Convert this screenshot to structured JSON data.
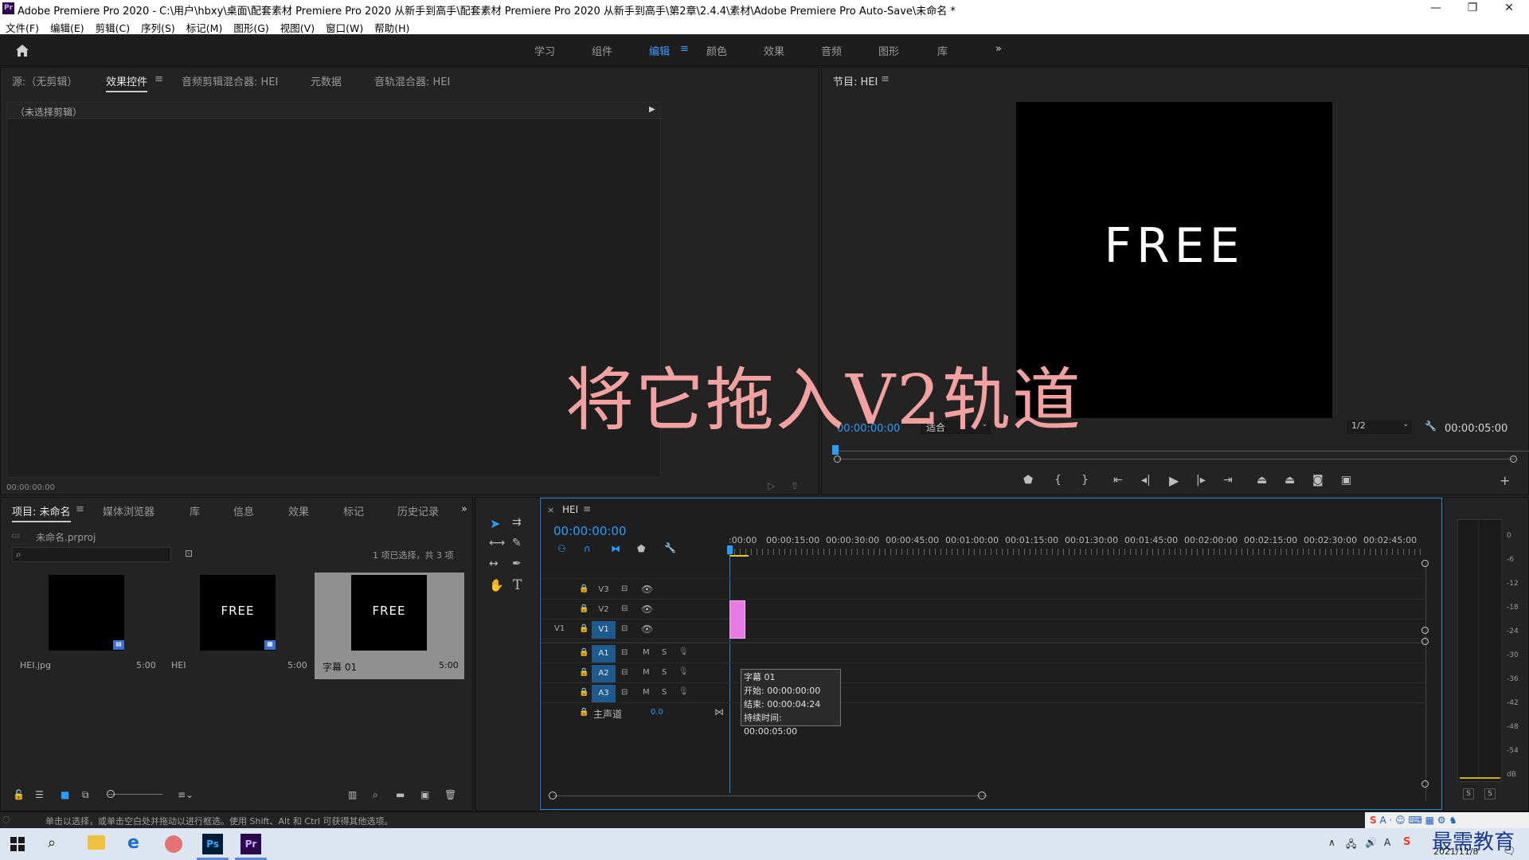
{
  "window": {
    "app_icon": "Pr",
    "title": "Adobe Premiere Pro 2020 - C:\\用户\\hbxy\\桌面\\配套素材 Premiere Pro 2020 从新手到高手\\配套素材 Premiere Pro 2020 从新手到高手\\第2章\\2.4.4\\素材\\Adobe Premiere Pro Auto-Save\\未命名 *",
    "minimize": "—",
    "maximize": "❐",
    "close": "✕"
  },
  "menu": [
    "文件(F)",
    "编辑(E)",
    "剪辑(C)",
    "序列(S)",
    "标记(M)",
    "图形(G)",
    "视图(V)",
    "窗口(W)",
    "帮助(H)"
  ],
  "workspaces": {
    "items": [
      "学习",
      "组件",
      "编辑",
      "颜色",
      "效果",
      "音频",
      "图形",
      "库"
    ],
    "active": "编辑",
    "menu_glyph": "≡",
    "more": "»"
  },
  "source_panel": {
    "tabs": [
      "源:（无剪辑）",
      "效果控件",
      "音频剪辑混合器: HEI",
      "元数据",
      "音轨混合器: HEI"
    ],
    "active_tab": "效果控件",
    "menu_glyph": "≡",
    "no_clip": "（未选择剪辑）",
    "timecode": "00:00:00:00"
  },
  "program": {
    "tab": "节目: HEI",
    "menu_glyph": "≡",
    "frame_text": "FREE",
    "timecode": "00:00:00:00",
    "fit": "适合",
    "resolution": "1/2",
    "duration": "00:00:05:00"
  },
  "overlay_caption": "将它拖入V2轨道",
  "project": {
    "tabs": [
      "项目: 未命名",
      "媒体浏览器",
      "库",
      "信息",
      "效果",
      "标记",
      "历史记录"
    ],
    "active_tab": "项目: 未命名",
    "menu_glyph": "≡",
    "more": "»",
    "file": "未命名.prproj",
    "selection": "1 项已选择，共 3 项",
    "items": [
      {
        "name": "HEI.jpg",
        "duration": "5:00",
        "text": ""
      },
      {
        "name": "HEI",
        "duration": "5:00",
        "text": "FREE"
      },
      {
        "name": "字幕 01",
        "duration": "5:00",
        "text": "FREE"
      }
    ]
  },
  "timeline": {
    "close": "×",
    "tab": "HEI",
    "menu_glyph": "≡",
    "timecode": "00:00:00:00",
    "ruler": [
      ":00:00",
      "00:00:15:00",
      "00:00:30:00",
      "00:00:45:00",
      "00:01:00:00",
      "00:01:15:00",
      "00:01:30:00",
      "00:01:45:00",
      "00:02:00:00",
      "00:02:15:00",
      "00:02:30:00",
      "00:02:45:00"
    ],
    "video_tracks": [
      {
        "label": "V3"
      },
      {
        "label": "V2"
      },
      {
        "label": "V1",
        "source": "V1"
      }
    ],
    "audio_tracks": [
      {
        "label": "A1",
        "m": "M",
        "s": "S"
      },
      {
        "label": "A2",
        "m": "M",
        "s": "S"
      },
      {
        "label": "A3",
        "m": "M",
        "s": "S"
      }
    ],
    "master": {
      "label": "主声道",
      "value": "0.0"
    },
    "tooltip": {
      "name": "字幕 01",
      "start": "开始: 00:00:00:00",
      "end": "结束: 00:00:04:24",
      "duration": "持续时间: 00:00:05:00"
    },
    "clip_color": "#e77be3"
  },
  "meter": {
    "scale": [
      "0",
      "-6",
      "-12",
      "-18",
      "-24",
      "-30",
      "-36",
      "-42",
      "-48",
      "-54",
      "dB"
    ],
    "solo": [
      "S",
      "S"
    ]
  },
  "status": "单击以选择，或单击空白处并拖动以进行框选。使用 Shift、Alt 和 Ctrl 可获得其他选项。",
  "taskbar": {
    "date": "2021/11/8",
    "watermark": "最需教育",
    "ps": "Ps",
    "pr": "Pr"
  },
  "colors": {
    "accent": "#2b9cff",
    "panel": "#232323",
    "caption": "#f2a0a0"
  }
}
